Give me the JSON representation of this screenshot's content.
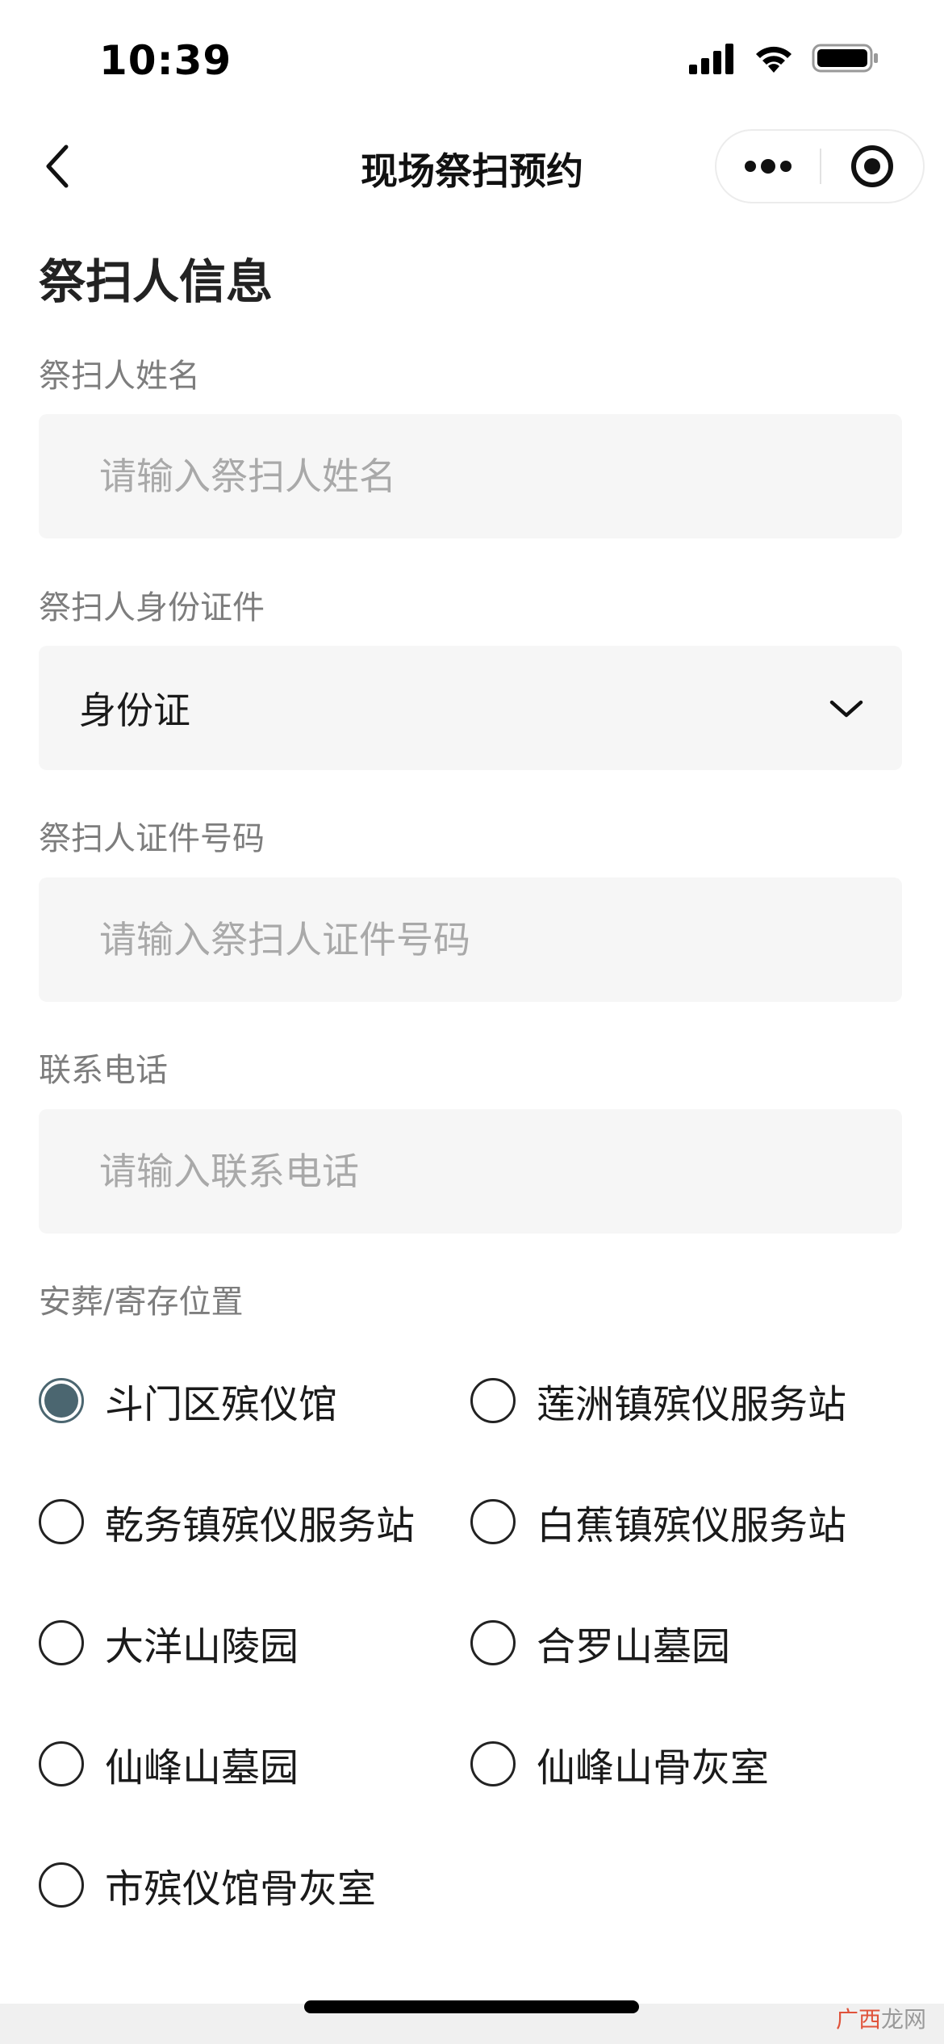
{
  "status_bar": {
    "time": "10:39",
    "icons": [
      "signal-icon",
      "wifi-icon",
      "battery-icon"
    ]
  },
  "nav": {
    "title": "现场祭扫预约",
    "back_icon": "chevron-left-icon",
    "more_icon": "more-icon",
    "close_icon": "target-icon"
  },
  "form": {
    "section_title": "祭扫人信息",
    "name": {
      "label": "祭扫人姓名",
      "placeholder": "请输入祭扫人姓名",
      "value": ""
    },
    "id_type": {
      "label": "祭扫人身份证件",
      "value": "身份证"
    },
    "id_number": {
      "label": "祭扫人证件号码",
      "placeholder": "请输入祭扫人证件号码",
      "value": ""
    },
    "phone": {
      "label": "联系电话",
      "placeholder": "请输入联系电话",
      "value": ""
    },
    "location": {
      "label": "安葬/寄存位置",
      "options": [
        {
          "label": "斗门区殡仪馆",
          "checked": true
        },
        {
          "label": "莲洲镇殡仪服务站",
          "checked": false
        },
        {
          "label": "乾务镇殡仪服务站",
          "checked": false
        },
        {
          "label": "白蕉镇殡仪服务站",
          "checked": false
        },
        {
          "label": "大洋山陵园",
          "checked": false
        },
        {
          "label": "合罗山墓园",
          "checked": false
        },
        {
          "label": "仙峰山墓园",
          "checked": false
        },
        {
          "label": "仙峰山骨灰室",
          "checked": false
        },
        {
          "label": "市殡仪馆骨灰室",
          "checked": false
        }
      ]
    }
  },
  "colors": {
    "accent": "#4b6670",
    "input_bg": "#f6f6f6",
    "label": "#7d7d7d",
    "placeholder": "#a9a9a9"
  },
  "watermark": {
    "part1": "广西",
    "part2": "龙网"
  }
}
